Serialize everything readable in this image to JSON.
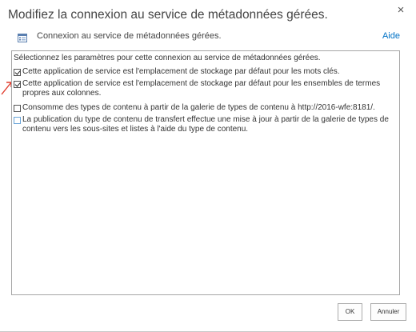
{
  "dialog": {
    "title": "Modifiez la connexion au service de métadonnées gérées.",
    "close_symbol": "×"
  },
  "header": {
    "icon": "connexion-icon",
    "label": "Connexion au service de métadonnées gérées.",
    "help_link": "Aide"
  },
  "options_box": {
    "intro": "Sélectionnez les paramètres pour cette connexion au service de métadonnées gérées.",
    "options": [
      {
        "label": "Cette application de service est l'emplacement de stockage par défaut pour les mots clés.",
        "checked": true
      },
      {
        "label": "Cette application de service est l'emplacement de stockage par défaut pour les ensembles de termes propres aux colonnes.",
        "checked": true
      },
      {
        "label": "Consomme des types de contenu à partir de la galerie de types de contenu à http://2016-wfe:8181/.",
        "checked": false
      },
      {
        "label": "La publication du type de contenu de transfert effectue une mise à jour à partir de la galerie de types de contenu vers les sous-sites et listes à l'aide du type de contenu.",
        "checked": false
      }
    ]
  },
  "annotation": {
    "icon": "red-arrow-icon",
    "color": "#e03b2c"
  },
  "footer": {
    "ok_label": "OK",
    "cancel_label": "Annuler"
  },
  "colors": {
    "link": "#0072c6",
    "border": "#a6a6a6"
  }
}
